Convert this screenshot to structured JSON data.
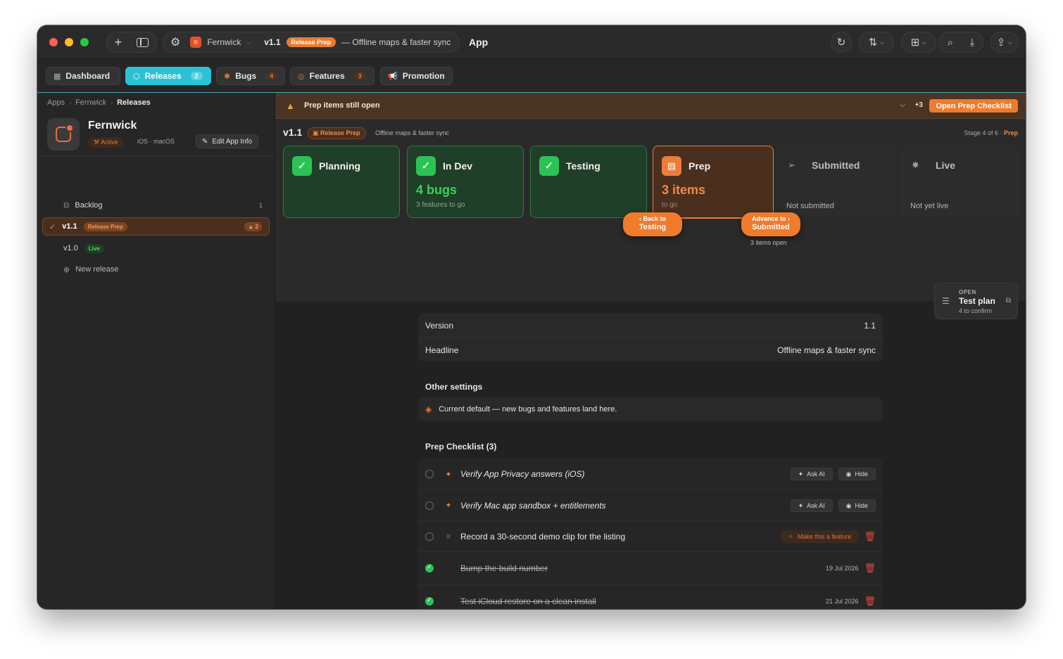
{
  "window": {
    "title_app": "Fernwick",
    "title_version": "v1.1",
    "title_badge": "Release Prep",
    "title_headline": "— Offline maps & faster sync",
    "title_center": "App"
  },
  "tabs": [
    {
      "label": "Dashboard",
      "count": ""
    },
    {
      "label": "Releases",
      "count": "2"
    },
    {
      "label": "Bugs",
      "count": "4"
    },
    {
      "label": "Features",
      "count": "3"
    },
    {
      "label": "Promotion",
      "count": ""
    }
  ],
  "sidebar": {
    "breadcrumbs": [
      "Apps",
      "Fernwick",
      "Releases"
    ],
    "app_name": "Fernwick",
    "app_status": "Active",
    "app_platforms": "iOS · macOS",
    "edit_label": "Edit App Info",
    "backlog_label": "Backlog",
    "backlog_count": "1",
    "releases": [
      {
        "version": "v1.1",
        "badge": "Release Prep",
        "warn": "2"
      },
      {
        "version": "v1.0",
        "badge": "Live"
      }
    ],
    "new_release": "New release"
  },
  "banner": {
    "text": "Prep items still open",
    "more": "+3",
    "button": "Open Prep Checklist"
  },
  "release": {
    "version": "v1.1",
    "badge": "Release Prep",
    "headline": "Offline maps & faster sync",
    "stage_label": "Stage 4 of 6",
    "stage_name": "Prep"
  },
  "stages": [
    {
      "name": "Planning",
      "big": "",
      "sub": ""
    },
    {
      "name": "In Dev",
      "big": "4 bugs",
      "sub": "3 features to go"
    },
    {
      "name": "Testing",
      "big": "",
      "sub": ""
    },
    {
      "name": "Prep",
      "big": "3 items",
      "sub": "to go"
    },
    {
      "name": "Submitted",
      "note": "Not submitted"
    },
    {
      "name": "Live",
      "note": "Not yet live"
    }
  ],
  "flow": {
    "back_top": "Back to",
    "back_bottom": "Testing",
    "adv_top": "Advance to",
    "adv_bottom": "Submitted",
    "adv_note": "3 items open"
  },
  "testplan": {
    "label": "OPEN",
    "title": "Test plan",
    "sub": "4 to confirm"
  },
  "fields": [
    {
      "key": "Version",
      "value": "1.1"
    },
    {
      "key": "Headline",
      "value": "Offline maps & faster sync"
    }
  ],
  "other": {
    "title": "Other settings",
    "text": "Current default — new bugs and features land here."
  },
  "checklist": {
    "title": "Prep Checklist (3)",
    "ask_ai": "Ask AI",
    "hide": "Hide",
    "make_feature": "Make this a feature",
    "items": [
      {
        "text": "Verify App Privacy answers (iOS)"
      },
      {
        "text": "Verify Mac app sandbox + entitlements"
      },
      {
        "text": "Record a 30-second demo clip for the listing"
      },
      {
        "text": "Bump the build number",
        "date": "19 Jul 2026"
      },
      {
        "text": "Test iCloud restore on a clean install",
        "date": "21 Jul 2026"
      }
    ]
  }
}
